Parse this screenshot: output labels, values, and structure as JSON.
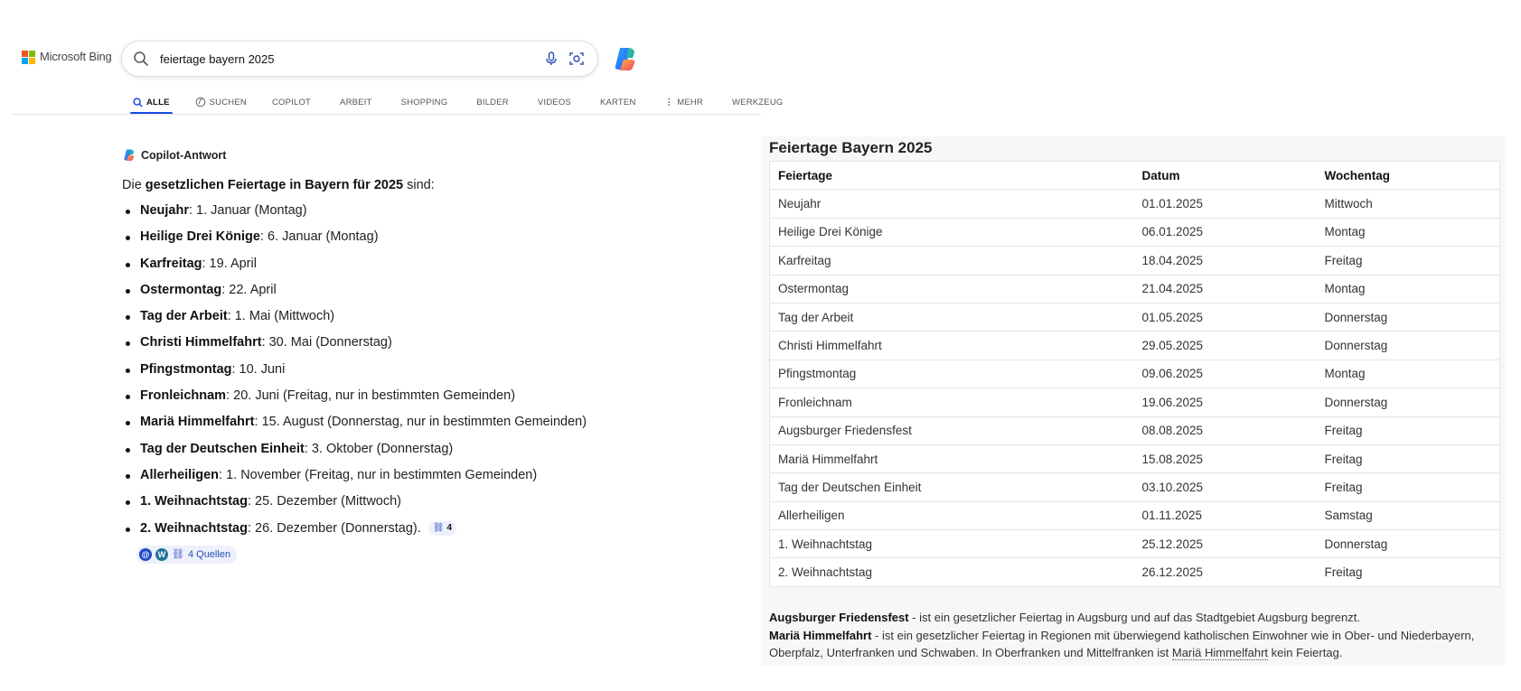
{
  "header": {
    "logo_text": "Microsoft Bing",
    "search_value": "feiertage bayern 2025"
  },
  "tabs": [
    {
      "label": "ALLE",
      "icon": "search-icon",
      "active": true
    },
    {
      "label": "SUCHEN",
      "icon": "copilot-search-icon"
    },
    {
      "label": "COPILOT"
    },
    {
      "label": "ARBEIT"
    },
    {
      "label": "SHOPPING"
    },
    {
      "label": "BILDER"
    },
    {
      "label": "VIDEOS"
    },
    {
      "label": "KARTEN"
    },
    {
      "label": "MEHR",
      "icon": "more-vertical-icon"
    },
    {
      "label": "WERKZEUG"
    }
  ],
  "answer": {
    "heading": "Copilot-Antwort",
    "intro_pre": "Die ",
    "intro_bold": "gesetzlichen Feiertage in Bayern für 2025",
    "intro_post": " sind:",
    "items": [
      {
        "name": "Neujahr",
        "detail": ": 1. Januar (Montag)"
      },
      {
        "name": "Heilige Drei Könige",
        "detail": ": 6. Januar (Montag)"
      },
      {
        "name": "Karfreitag",
        "detail": ": 19. April"
      },
      {
        "name": "Ostermontag",
        "detail": ": 22. April"
      },
      {
        "name": "Tag der Arbeit",
        "detail": ": 1. Mai (Mittwoch)"
      },
      {
        "name": "Christi Himmelfahrt",
        "detail": ": 30. Mai (Donnerstag)"
      },
      {
        "name": "Pfingstmontag",
        "detail": ": 10. Juni"
      },
      {
        "name": "Fronleichnam",
        "detail": ": 20. Juni (Freitag, nur in bestimmten Gemeinden)"
      },
      {
        "name": "Mariä Himmelfahrt",
        "detail": ": 15. August (Donnerstag, nur in bestimmten Gemeinden)"
      },
      {
        "name": "Tag der Deutschen Einheit",
        "detail": ": 3. Oktober (Donnerstag)"
      },
      {
        "name": "Allerheiligen",
        "detail": ": 1. November (Freitag, nur in bestimmten Gemeinden)"
      },
      {
        "name": "1. Weihnachtstag",
        "detail": ": 25. Dezember (Mittwoch)"
      },
      {
        "name": "2. Weihnachtstag",
        "detail": ": 26. Dezember (Donnerstag)."
      }
    ],
    "citation_count": "4",
    "sources_label": "4 Quellen"
  },
  "table_panel": {
    "title": "Feiertage Bayern 2025",
    "columns": [
      "Feiertage",
      "Datum",
      "Wochentag"
    ],
    "rows": [
      [
        "Neujahr",
        "01.01.2025",
        "Mittwoch"
      ],
      [
        "Heilige Drei Könige",
        "06.01.2025",
        "Montag"
      ],
      [
        "Karfreitag",
        "18.04.2025",
        "Freitag"
      ],
      [
        "Ostermontag",
        "21.04.2025",
        "Montag"
      ],
      [
        "Tag der Arbeit",
        "01.05.2025",
        "Donnerstag"
      ],
      [
        "Christi Himmelfahrt",
        "29.05.2025",
        "Donnerstag"
      ],
      [
        "Pfingstmontag",
        "09.06.2025",
        "Montag"
      ],
      [
        "Fronleichnam",
        "19.06.2025",
        "Donnerstag"
      ],
      [
        "Augsburger Friedensfest",
        "08.08.2025",
        "Freitag"
      ],
      [
        "Mariä Himmelfahrt",
        "15.08.2025",
        "Freitag"
      ],
      [
        "Tag der Deutschen Einheit",
        "03.10.2025",
        "Freitag"
      ],
      [
        "Allerheiligen",
        "01.11.2025",
        "Samstag"
      ],
      [
        "1. Weihnachtstag",
        "25.12.2025",
        "Donnerstag"
      ],
      [
        "2. Weihnachtstag",
        "26.12.2025",
        "Freitag"
      ]
    ],
    "note1_bold": "Augsburger Friedensfest",
    "note1_text": " - ist ein gesetzlicher Feiertag in Augsburg und auf das Stadtgebiet Augsburg begrenzt.",
    "note2_bold": "Mariä Himmelfahrt",
    "note2_text": " - ist ein gesetzlicher Feiertag in Regionen mit überwiegend katholischen Einwohner wie in Ober- und Niederbayern, Oberpfalz, Unterfranken und Schwaben. In Oberfranken und Mittelfranken ist ",
    "note2_link": "Mariä Himmelfahrt",
    "note2_end": " kein Feiertag."
  },
  "colors": {
    "accent": "#174ae4",
    "chip_bg": "#eef1fb",
    "chip_text": "#2b4db8",
    "panel_bg": "#f7f7f7"
  }
}
